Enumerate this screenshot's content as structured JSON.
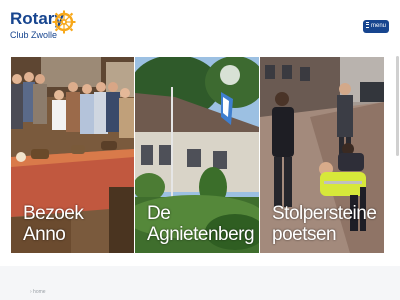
{
  "logo": {
    "title": "Rotary",
    "subtitle": "Club Zwolle"
  },
  "header": {
    "menu_label": "menu"
  },
  "panels": [
    {
      "caption_lines": [
        "Bezoek",
        "Anno"
      ]
    },
    {
      "caption_lines": [
        "De",
        "Agnietenberg"
      ]
    },
    {
      "caption_lines": [
        "Stolpersteine",
        "poetsen"
      ]
    }
  ],
  "breadcrumb": "› home",
  "colors": {
    "brand": "#17458f",
    "gold": "#f7a81b"
  }
}
